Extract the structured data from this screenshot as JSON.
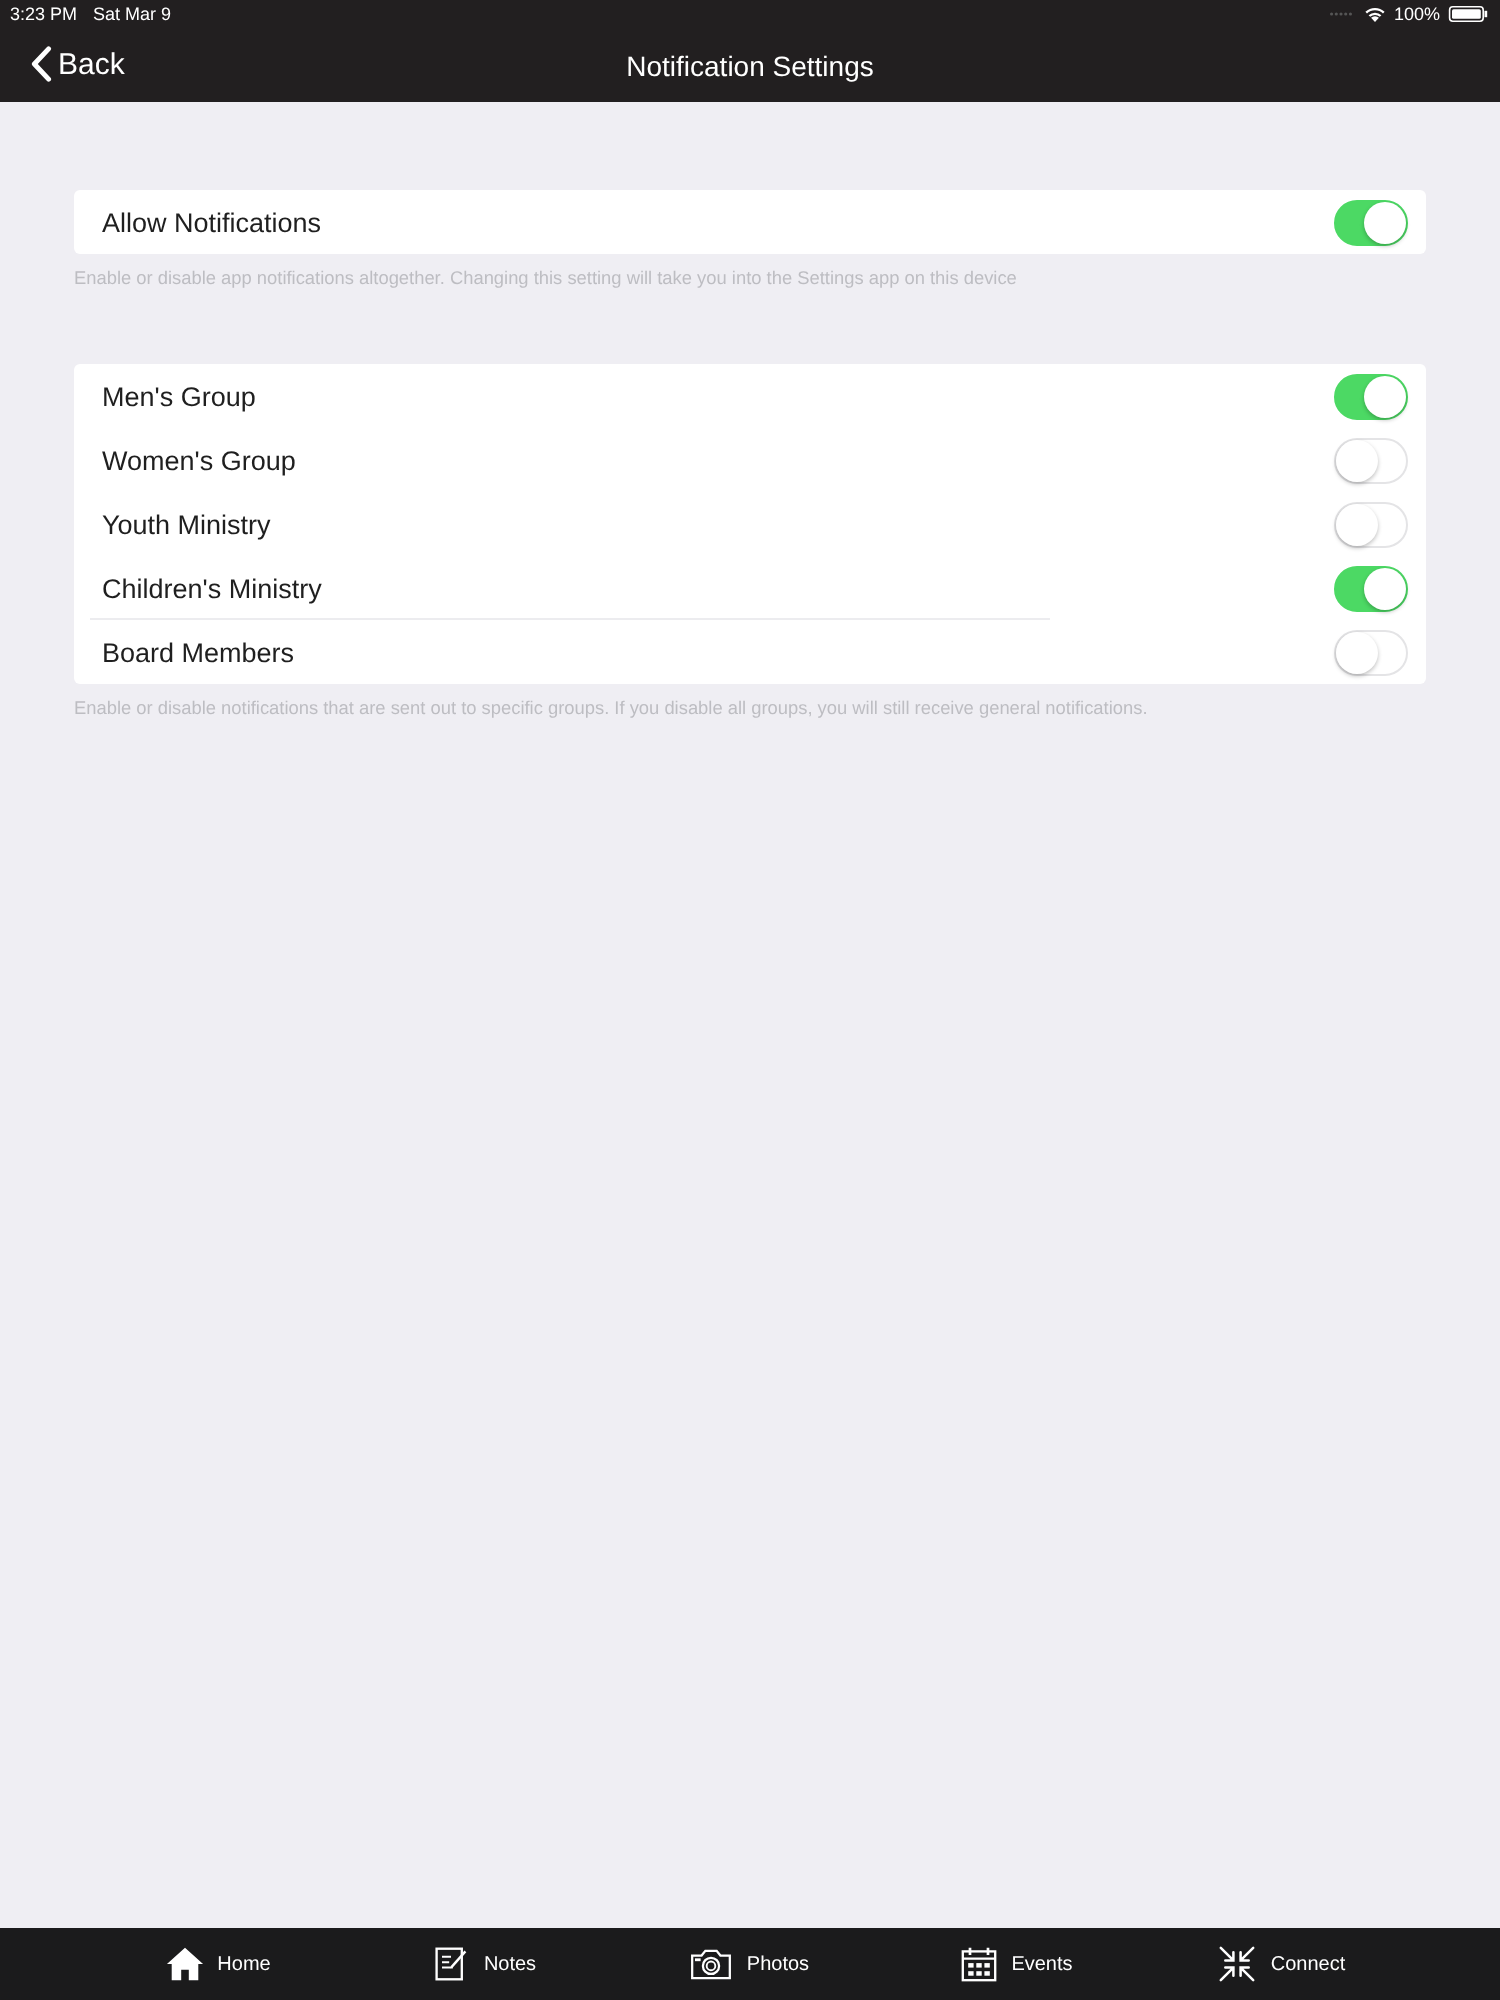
{
  "status_bar": {
    "time": "3:23 PM",
    "date": "Sat Mar 9",
    "battery": "100%"
  },
  "nav_bar": {
    "back": "Back",
    "title": "Notification Settings"
  },
  "sections": [
    {
      "rows": [
        {
          "label": "Allow Notifications",
          "on": true,
          "separator": false
        }
      ],
      "footer": "Enable or disable app notifications altogether. Changing this setting will take you into the Settings app on this device"
    },
    {
      "rows": [
        {
          "label": "Men's Group",
          "on": true,
          "separator": false
        },
        {
          "label": "Women's Group",
          "on": false,
          "separator": false
        },
        {
          "label": "Youth Ministry",
          "on": false,
          "separator": false
        },
        {
          "label": "Children's Ministry",
          "on": true,
          "separator": true
        },
        {
          "label": "Board Members",
          "on": false,
          "separator": false
        }
      ],
      "footer": "Enable or disable notifications that are sent out to specific groups. If you disable all groups, you will still receive general notifications."
    }
  ],
  "tab_bar": [
    {
      "label": "Home",
      "kind": "home"
    },
    {
      "label": "Notes",
      "kind": "notes"
    },
    {
      "label": "Photos",
      "kind": "photos"
    },
    {
      "label": "Events",
      "kind": "events"
    },
    {
      "label": "Connect",
      "kind": "connect"
    }
  ]
}
